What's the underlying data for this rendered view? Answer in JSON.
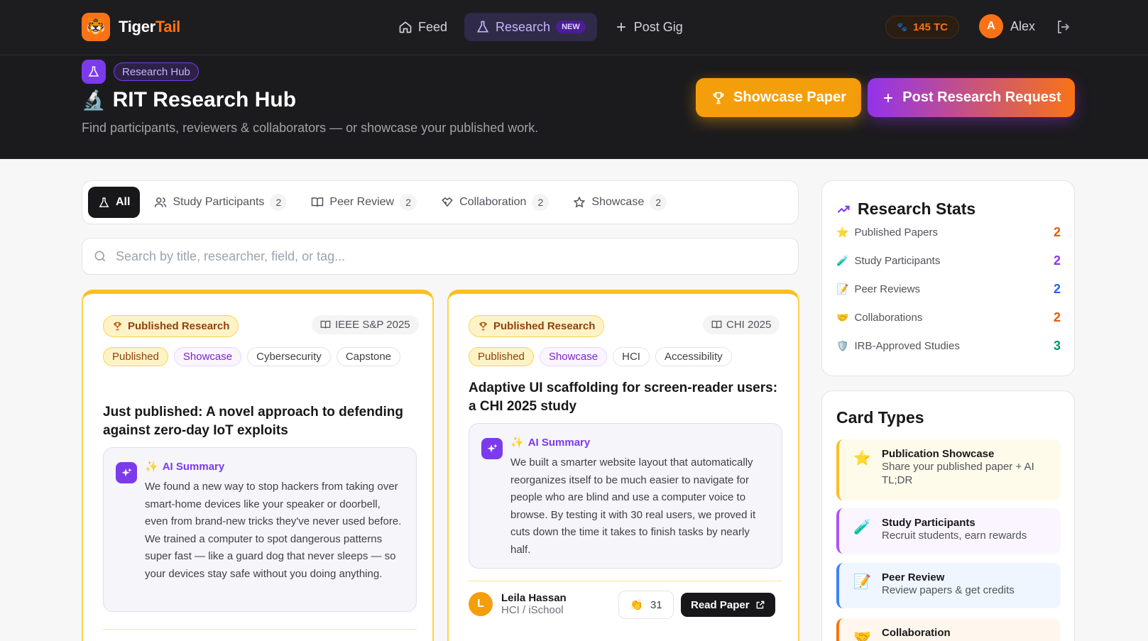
{
  "app": {
    "name_a": "Tiger",
    "name_b": "Tail"
  },
  "nav": {
    "feed": "Feed",
    "research": "Research",
    "research_badge": "NEW",
    "post_gig": "Post Gig"
  },
  "wallet": {
    "balance": "145 TC"
  },
  "user": {
    "initial": "A",
    "name": "Alex"
  },
  "hero": {
    "pill": "Research Hub",
    "title": "RIT Research Hub",
    "subtitle": "Find participants, reviewers & collaborators — or showcase your published work.",
    "showcase_button": "Showcase Paper",
    "post_button": "Post Research Request"
  },
  "filters": [
    {
      "label": "All"
    },
    {
      "label": "Study Participants",
      "count": "2"
    },
    {
      "label": "Peer Review",
      "count": "2"
    },
    {
      "label": "Collaboration",
      "count": "2"
    },
    {
      "label": "Showcase",
      "count": "2"
    }
  ],
  "search": {
    "placeholder": "Search by title, researcher, field, or tag..."
  },
  "cards": [
    {
      "badge": "Published Research",
      "venue": "IEEE S&P 2025",
      "tags": [
        "Published",
        "Showcase",
        "Cybersecurity",
        "Capstone"
      ],
      "title": "Just published: A novel approach to defending against zero-day IoT exploits",
      "summary_label": "AI Summary",
      "summary": "We found a new way to stop hackers from taking over smart-home devices like your speaker or doorbell, even from brand-new tricks they've never used before. We trained a computer to spot dangerous patterns super fast — like a guard dog that never sleeps — so your devices stay safe without you doing anything."
    },
    {
      "badge": "Published Research",
      "venue": "CHI 2025",
      "tags": [
        "Published",
        "Showcase",
        "HCI",
        "Accessibility"
      ],
      "title": "Adaptive UI scaffolding for screen-reader users: a CHI 2025 study",
      "summary_label": "AI Summary",
      "summary": "We built a smarter website layout that automatically reorganizes itself to be much easier to navigate for people who are blind and use a computer voice to browse. By testing it with 30 real users, we proved it cuts down the time it takes to finish tasks by nearly half.",
      "author_initial": "L",
      "author": "Leila Hassan",
      "dept": "HCI / iSchool",
      "claps": "31",
      "read": "Read Paper"
    }
  ],
  "stats": {
    "title": "Research Stats",
    "rows": [
      {
        "icon": "⭐",
        "label": "Published Papers",
        "value": "2",
        "color": "#ea580c"
      },
      {
        "icon": "🧪",
        "label": "Study Participants",
        "value": "2",
        "color": "#9333ea"
      },
      {
        "icon": "📝",
        "label": "Peer Reviews",
        "value": "2",
        "color": "#2563eb"
      },
      {
        "icon": "🤝",
        "label": "Collaborations",
        "value": "2",
        "color": "#ea580c"
      },
      {
        "icon": "🛡️",
        "label": "IRB-Approved Studies",
        "value": "3",
        "color": "#059669"
      }
    ]
  },
  "types": {
    "title": "Card Types",
    "items": [
      {
        "icon": "⭐",
        "name": "Publication Showcase",
        "desc": "Share your published paper + AI TL;DR"
      },
      {
        "icon": "🧪",
        "name": "Study Participants",
        "desc": "Recruit students, earn rewards"
      },
      {
        "icon": "📝",
        "name": "Peer Review",
        "desc": "Review papers & get credits"
      },
      {
        "icon": "🤝",
        "name": "Collaboration",
        "desc": ""
      }
    ]
  },
  "colors": {
    "accent": "#f97316",
    "purple": "#7c3aed",
    "amber": "#f59e0b",
    "dark": "#1d1d20"
  }
}
